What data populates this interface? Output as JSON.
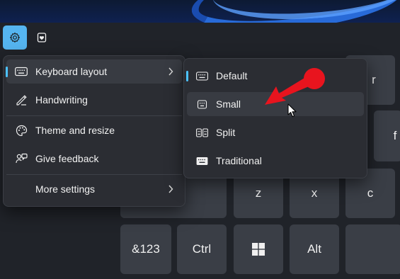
{
  "keyboard": {
    "keys": {
      "r": "r",
      "f": "f",
      "z": "z",
      "x": "x",
      "c": "c",
      "sym": "&123",
      "ctrl": "Ctrl",
      "alt": "Alt"
    }
  },
  "settings_menu": {
    "items": [
      {
        "label": "Keyboard layout",
        "icon": "keyboard-icon"
      },
      {
        "label": "Handwriting",
        "icon": "pen-icon"
      },
      {
        "label": "Theme and resize",
        "icon": "palette-icon"
      },
      {
        "label": "Give feedback",
        "icon": "feedback-icon"
      },
      {
        "label": "More settings",
        "icon": ""
      }
    ]
  },
  "layout_menu": {
    "items": [
      {
        "label": "Default",
        "icon": "keyboard-icon"
      },
      {
        "label": "Small",
        "icon": "small-keyboard-icon"
      },
      {
        "label": "Split",
        "icon": "split-keyboard-icon"
      },
      {
        "label": "Traditional",
        "icon": "traditional-keyboard-icon"
      }
    ]
  },
  "colors": {
    "accent": "#4cc2ff",
    "settings_button": "#55b5f0",
    "annotation_arrow": "#e8141e",
    "panel_bg": "#202329",
    "key_bg": "#3a3e46"
  }
}
